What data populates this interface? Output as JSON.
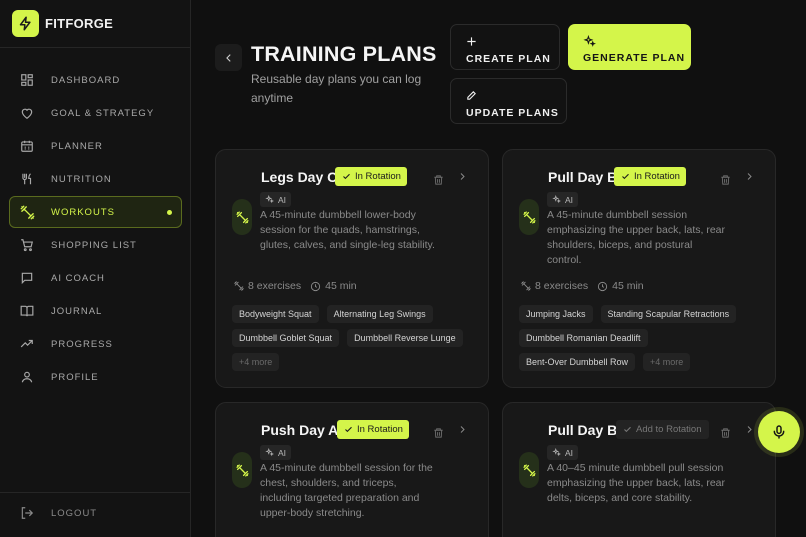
{
  "brand": {
    "name": "FITFORGE",
    "logo_icon": "bolt-icon",
    "accent": "#d4f54a"
  },
  "sidebar": {
    "items": [
      {
        "label": "DASHBOARD",
        "icon": "grid-icon"
      },
      {
        "label": "GOAL & STRATEGY",
        "icon": "heart-icon"
      },
      {
        "label": "PLANNER",
        "icon": "calendar-icon"
      },
      {
        "label": "NUTRITION",
        "icon": "fork-knife-icon"
      },
      {
        "label": "WORKOUTS",
        "icon": "dumbbell-icon",
        "active": true
      },
      {
        "label": "SHOPPING LIST",
        "icon": "cart-icon"
      },
      {
        "label": "AI COACH",
        "icon": "chat-icon"
      },
      {
        "label": "JOURNAL",
        "icon": "book-icon"
      },
      {
        "label": "PROGRESS",
        "icon": "trend-icon"
      },
      {
        "label": "PROFILE",
        "icon": "user-icon"
      }
    ],
    "logout": {
      "label": "LOGOUT",
      "icon": "logout-icon"
    }
  },
  "header": {
    "title": "TRAINING PLANS",
    "subtitle": "Reusable day plans you can log anytime",
    "create_label": "CREATE PLAN",
    "generate_label": "GENERATE PLAN",
    "update_label": "UPDATE PLANS"
  },
  "cards": [
    {
      "title": "Legs Day C",
      "status": "In Rotation",
      "ai": "AI",
      "description": "A 45-minute dumbbell lower-body session for the quads, hamstrings, glutes, calves, and single-leg stability.",
      "exercises": "8 exercises",
      "duration": "45 min",
      "chips": [
        "Bodyweight Squat",
        "Alternating Leg Swings",
        "Dumbbell Goblet Squat",
        "Dumbbell Reverse Lunge"
      ],
      "more": "+4 more"
    },
    {
      "title": "Pull Day B",
      "status": "In Rotation",
      "ai": "AI",
      "description": "A 45-minute dumbbell session emphasizing the upper back, lats, rear shoulders, biceps, and postural control.",
      "exercises": "8 exercises",
      "duration": "45 min",
      "chips": [
        "Jumping Jacks",
        "Standing Scapular Retractions",
        "Dumbbell Romanian Deadlift",
        "Bent-Over Dumbbell Row"
      ],
      "more": "+4 more"
    },
    {
      "title": "Push Day A",
      "status": "In Rotation",
      "ai": "AI",
      "description": "A 45-minute dumbbell session for the chest, shoulders, and triceps, including targeted preparation and upper-body stretching."
    },
    {
      "title": "Pull Day B",
      "status": "Add to Rotation",
      "ai": "AI",
      "description": "A 40–45 minute dumbbell pull session emphasizing the upper back, lats, rear delts, biceps, and core stability."
    }
  ],
  "mic": {
    "icon": "microphone-icon"
  }
}
